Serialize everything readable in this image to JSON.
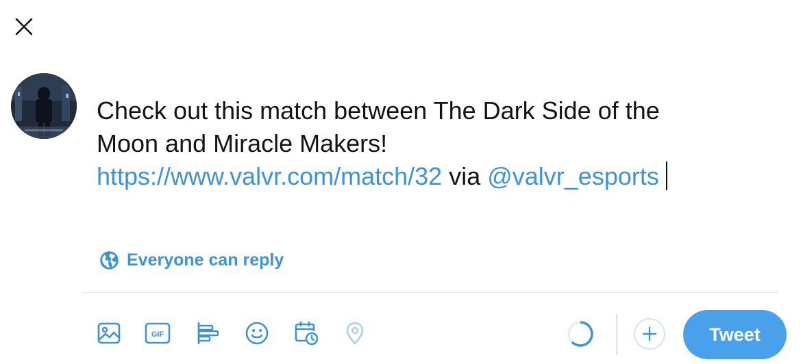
{
  "composer": {
    "text_line1": "Check out this match between The Dark Side of the",
    "text_line2": "Moon and Miracle Makers!",
    "link_url": "https://www.valvr.com/match/32",
    "via_text": " via ",
    "mention": "@valvr_esports"
  },
  "reply_setting": {
    "label": "Everyone can reply"
  },
  "toolbar": {
    "icons": [
      "image-icon",
      "gif-icon",
      "poll-icon",
      "emoji-icon",
      "schedule-icon",
      "location-icon"
    ],
    "tweet_label": "Tweet"
  },
  "colors": {
    "accent": "#3b93dc",
    "tweet_button": "#4aa1eb",
    "divider": "#e6ecf0",
    "text": "#0f1419"
  }
}
